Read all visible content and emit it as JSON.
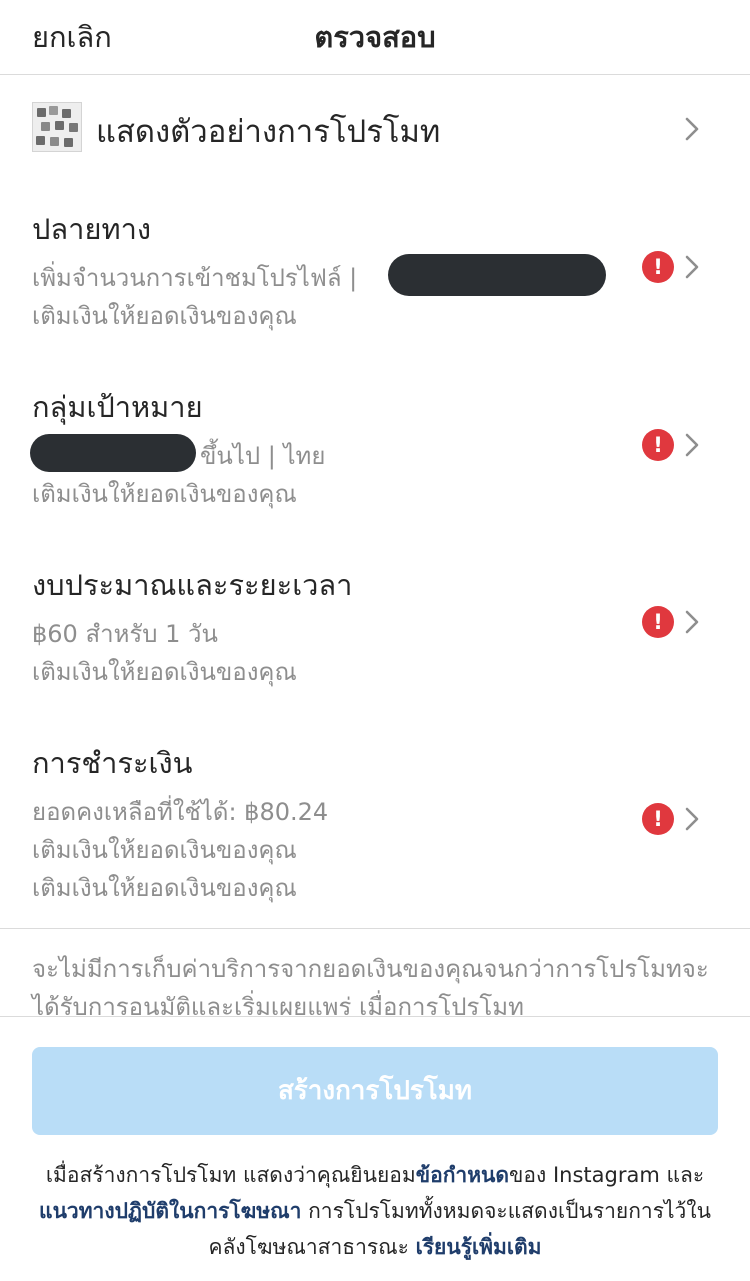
{
  "header": {
    "cancel_label": "ยกเลิก",
    "title": "ตรวจสอบ"
  },
  "preview": {
    "label": "แสดงตัวอย่างการโปรโมท",
    "icon": "chevron-right-icon"
  },
  "sections": [
    {
      "title": "ปลายทาง",
      "lines": [
        "เพิ่มจำนวนการเข้าชมโปรไฟล์ |",
        "เติมเงินให้ยอดเงินของคุณ"
      ],
      "alert": "!"
    },
    {
      "title": "กลุ่มเป้าหมาย",
      "lines": [
        "ขึ้นไป | ไทย",
        "เติมเงินให้ยอดเงินของคุณ"
      ],
      "alert": "!"
    },
    {
      "title": "งบประมาณและระยะเวลา",
      "lines": [
        "฿60 สำหรับ 1 วัน",
        "เติมเงินให้ยอดเงินของคุณ"
      ],
      "alert": "!"
    },
    {
      "title": "การชำระเงิน",
      "lines": [
        "ยอดคงเหลือที่ใช้ได้: ฿80.24",
        "เติมเงินให้ยอดเงินของคุณ",
        "เติมเงินให้ยอดเงินของคุณ"
      ],
      "alert": "!"
    }
  ],
  "disclaimer": "จะไม่มีการเก็บค่าบริการจากยอดเงินของคุณจนกว่าการโปรโมทจะได้รับการอนุมัติและเริ่มเผยแพร่ เมื่อการโปรโมท",
  "footer": {
    "create_button": "สร้างการโปรโมท",
    "terms_prefix": "เมื่อสร้างการโปรโมท แสดงว่าคุณยินยอม",
    "terms_link": "ข้อกำหนด",
    "terms_mid1": "ของ Instagram และ",
    "ads_policy_link": "แนวทางปฏิบัติในการโฆษณา",
    "terms_mid2": " การโปรโมททั้งหมดจะแสดงเป็นรายการไว้ในคลังโฆษณาสาธารณะ ",
    "learn_more_link": "เรียนรู้เพิ่มเติม"
  },
  "colors": {
    "alert": "#e0383e",
    "button_disabled": "#b9ddf7",
    "link": "#1f3d6b",
    "secondary_text": "#8e8e8e"
  }
}
